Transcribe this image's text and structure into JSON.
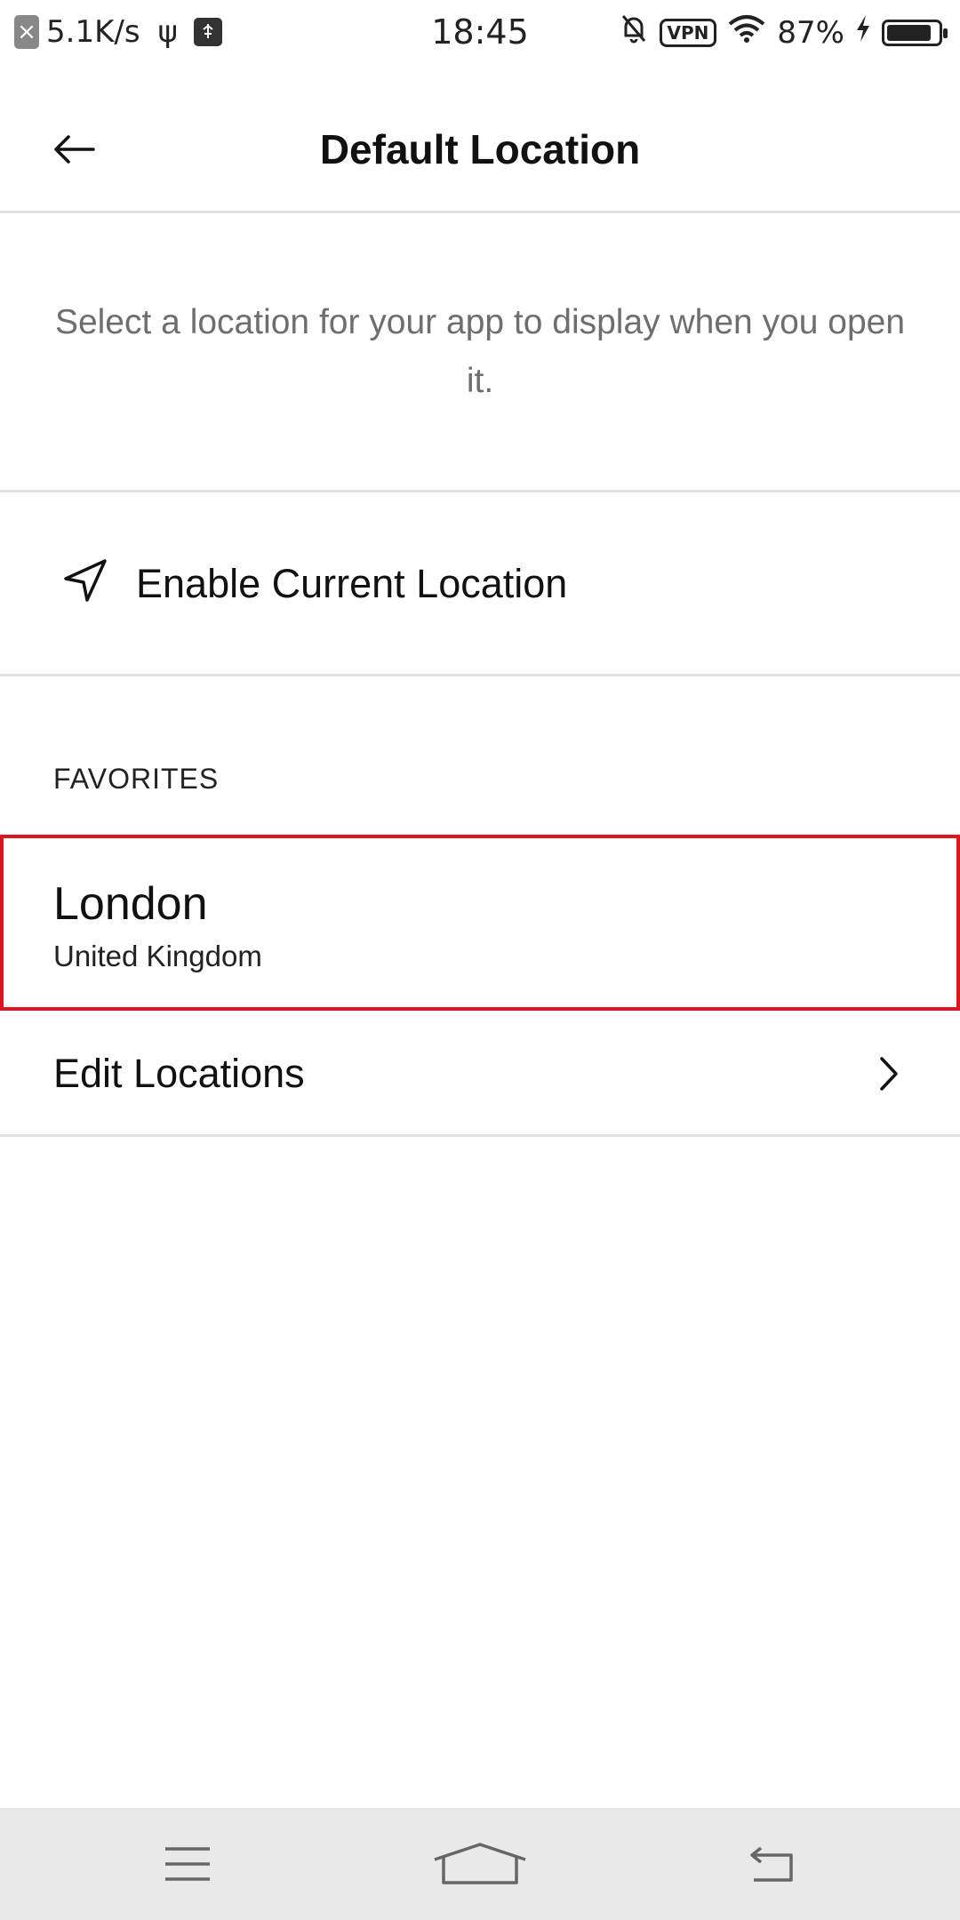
{
  "status_bar": {
    "x_badge": "×",
    "network_speed": "5.1K/s",
    "usb_symbol": "ψ",
    "time": "18:45",
    "vpn_label": "VPN",
    "battery_percent": "87%",
    "battery_level": 0.87
  },
  "header": {
    "title": "Default Location"
  },
  "description": "Select a location for your app to display when you open it.",
  "enable_location": {
    "label": "Enable Current Location"
  },
  "favorites": {
    "header": "FAVORITES",
    "items": [
      {
        "city": "London",
        "country": "United Kingdom"
      }
    ]
  },
  "edit_locations": {
    "label": "Edit Locations"
  },
  "colors": {
    "selection_border": "#e0141e",
    "divider": "#e2e2e2",
    "description_text": "#6e6e6e",
    "nav_bar_bg": "#e9e9e9"
  }
}
